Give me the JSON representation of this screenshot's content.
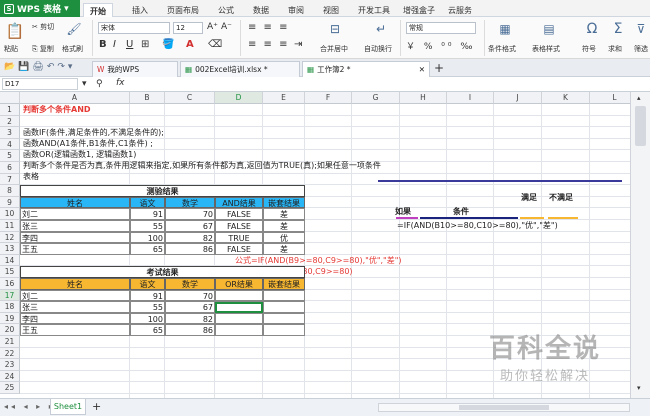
{
  "app": {
    "name": "WPS 表格"
  },
  "menu": [
    "开始",
    "插入",
    "页面布局",
    "公式",
    "数据",
    "审阅",
    "视图",
    "开发工具",
    "增强盒子",
    "云服务"
  ],
  "ribbon": {
    "paste": "粘贴",
    "cut": "剪切",
    "copy": "复制",
    "format_painter": "格式刷",
    "font": "宋体",
    "font_size": "12",
    "merge": "合并居中",
    "wrap": "自动换行",
    "number_format": "常规",
    "cond_format": "条件格式",
    "table_style": "表格样式",
    "symbol": "符号",
    "sum": "求和",
    "filter": "筛选"
  },
  "tabs": {
    "home": "我的WPS",
    "file": "002Excel培训.xlsx *",
    "active": "工作簿2 *"
  },
  "formula_bar": {
    "cell_ref": "D17",
    "fx": "fx",
    "value": ""
  },
  "columns": [
    "A",
    "B",
    "C",
    "D",
    "E",
    "F",
    "G",
    "H",
    "I",
    "J",
    "K",
    "L"
  ],
  "rows": [
    "1",
    "2",
    "3",
    "4",
    "5",
    "6",
    "7",
    "8",
    "9",
    "10",
    "11",
    "12",
    "13",
    "14",
    "15",
    "16",
    "17",
    "18",
    "19",
    "20",
    "21",
    "22",
    "23",
    "24",
    "25"
  ],
  "text_lines": {
    "r1": "判断多个条件AND",
    "r2": "函数IF(条件,满足条件的,不满足条件的);",
    "r3": "函数AND(A1条件,B1条件,C1条件) ;",
    "r4": "函数OR(逻辑函数1, 逻辑函数1)",
    "r5": "判断多个条件是否为真,条件用逻辑来指定,如果所有条件都为真,返回值为TRUE(真);如果任意一项条件",
    "r6": "表格"
  },
  "table1": {
    "title": "测验结果",
    "headers": [
      "姓名",
      "语文",
      "数学",
      "AND结果",
      "嵌套结果"
    ],
    "rows": [
      [
        "刘二",
        "91",
        "70",
        "FALSE",
        "差"
      ],
      [
        "张三",
        "55",
        "67",
        "FALSE",
        "差"
      ],
      [
        "李四",
        "100",
        "82",
        "TRUE",
        "优"
      ],
      [
        "王五",
        "65",
        "86",
        "FALSE",
        "差"
      ]
    ]
  },
  "formula_notes": {
    "n1": "公式=IF(AND(B9>=80,C9>=80),\"优\",\"差\")",
    "n2": "公式则为=AND(B9>=80,C9>=80)"
  },
  "table2": {
    "title": "考试结果",
    "headers": [
      "姓名",
      "语文",
      "数学",
      "OR结果",
      "嵌套结果"
    ],
    "rows": [
      [
        "刘二",
        "91",
        "70",
        "",
        ""
      ],
      [
        "张三",
        "55",
        "67",
        "",
        ""
      ],
      [
        "李四",
        "100",
        "82",
        "",
        ""
      ],
      [
        "王五",
        "65",
        "86",
        "",
        ""
      ]
    ]
  },
  "annotation": {
    "satisfy": "满足",
    "not_satisfy": "不满足",
    "if_label": "如果",
    "cond_label": "条件",
    "formula": "=IF(AND(B10>=80,C10>=80),\"优\",\"差\")"
  },
  "sheet": {
    "name": "Sheet1"
  },
  "watermark": {
    "big": "百科全说",
    "small": "助你轻松解决"
  },
  "colors": {
    "header_blue": "#29b6f6",
    "header_orange": "#f7b731",
    "brand_green": "#1e8f3e",
    "red_text": "#e53935"
  }
}
